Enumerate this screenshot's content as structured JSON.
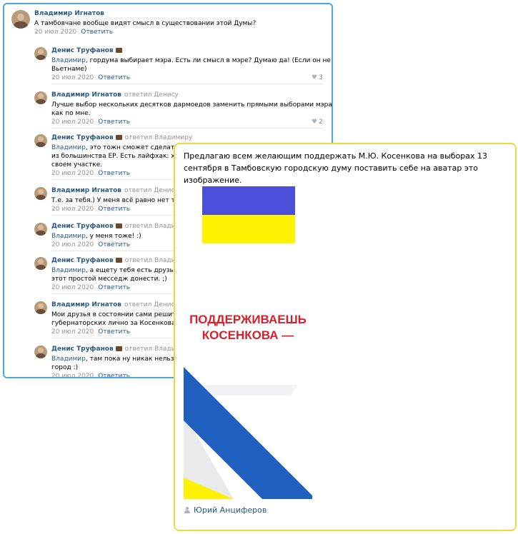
{
  "thread": {
    "comments": [
      {
        "author": "Владимир Игнатов",
        "replied_to": "",
        "mention": "",
        "lines": [
          "А тамбовчане вообще видят смысл в существовании этой Думы?"
        ],
        "date": "20 июл 2020",
        "reply": "Ответить",
        "likes": ""
      },
      {
        "author": "Денис Труфанов",
        "replied_to": "",
        "mention": "Владимир",
        "lines": [
          ", гордума выбирает мэра. Есть ли смысл в мэре? Думаю да! (Если он не во",
          "Вьетнаме)"
        ],
        "date": "20 июл 2020",
        "reply": "Ответить",
        "likes": "3"
      },
      {
        "author": "Владимир Игнатов",
        "replied_to": "ответил Денису",
        "mention": "",
        "lines": [
          "Лучше выбор нескольких десятков дармоедов заменить прямыми выборами мэра,",
          "как по мне."
        ],
        "date": "20 июл 2020",
        "reply": "Ответить",
        "likes": "2"
      },
      {
        "author": "Денис Труфанов",
        "replied_to": "ответил Владимиру",
        "mention": "Владимир",
        "lines": [
          ", это тожн сможет сделать то",
          "из большинства ЕР. Есть лайфхак: хоче",
          "своем участке."
        ],
        "date": "20 июл 2020",
        "reply": "Ответить",
        "likes": ""
      },
      {
        "author": "Владимир Игнатов",
        "replied_to": "ответил Денису",
        "mention": "",
        "lines": [
          "Т.е. за тебя.) У меня всё равно нет тамб"
        ],
        "date": "20 июл 2020",
        "reply": "Ответить",
        "likes": ""
      },
      {
        "author": "Денис Труфанов",
        "replied_to": "ответил Владимиру",
        "mention": "Владимир",
        "lines": [
          ", у меня тоже! :)"
        ],
        "date": "20 июл 2020",
        "reply": "Ответить",
        "likes": ""
      },
      {
        "author": "Денис Труфанов",
        "replied_to": "ответил Владимиру",
        "mention": "Владимир",
        "lines": [
          ", а ещету тебя есть друзья и з",
          "этот простой месседж донести. ;)"
        ],
        "date": "20 июл 2020",
        "reply": "Ответить",
        "likes": ""
      },
      {
        "author": "Владимир Игнатов",
        "replied_to": "ответил Денису",
        "mention": "",
        "lines": [
          "Мои друзья в состоянии сами решить,",
          "губернаторских лично за Косенкова я б"
        ],
        "date": "20 июл 2020",
        "reply": "Ответить",
        "likes": ""
      },
      {
        "author": "Денис Труфанов",
        "replied_to": "ответил Владимиру",
        "mention": "Владимир",
        "lines": [
          ", там пока ну никак нельзя бы",
          "город :)"
        ],
        "date": "20 июл 2020",
        "reply": "Ответить",
        "likes": ""
      }
    ]
  },
  "post": {
    "text": "Предлагаю всем желающим поддержать М.Ю. Косенкова на выборах 13 сентября в Тамбовскую городскую думу поставить себе на аватар это изображение.",
    "image": {
      "line1": "ПОДДЕРЖИВАЕШЬ",
      "line2": "КОСЕНКОВА —",
      "colors": {
        "blue": "#4a50d9",
        "yellow": "#fff200",
        "red": "#d8202a",
        "ribbon_blue": "#1f5fbf"
      }
    },
    "author": "Юрий Анциферов",
    "author_icon": "user-icon"
  },
  "colors": {
    "thread_border": "#4aa8e0",
    "post_border": "#f2d73c",
    "link": "#2a5885",
    "muted": "#939393"
  }
}
